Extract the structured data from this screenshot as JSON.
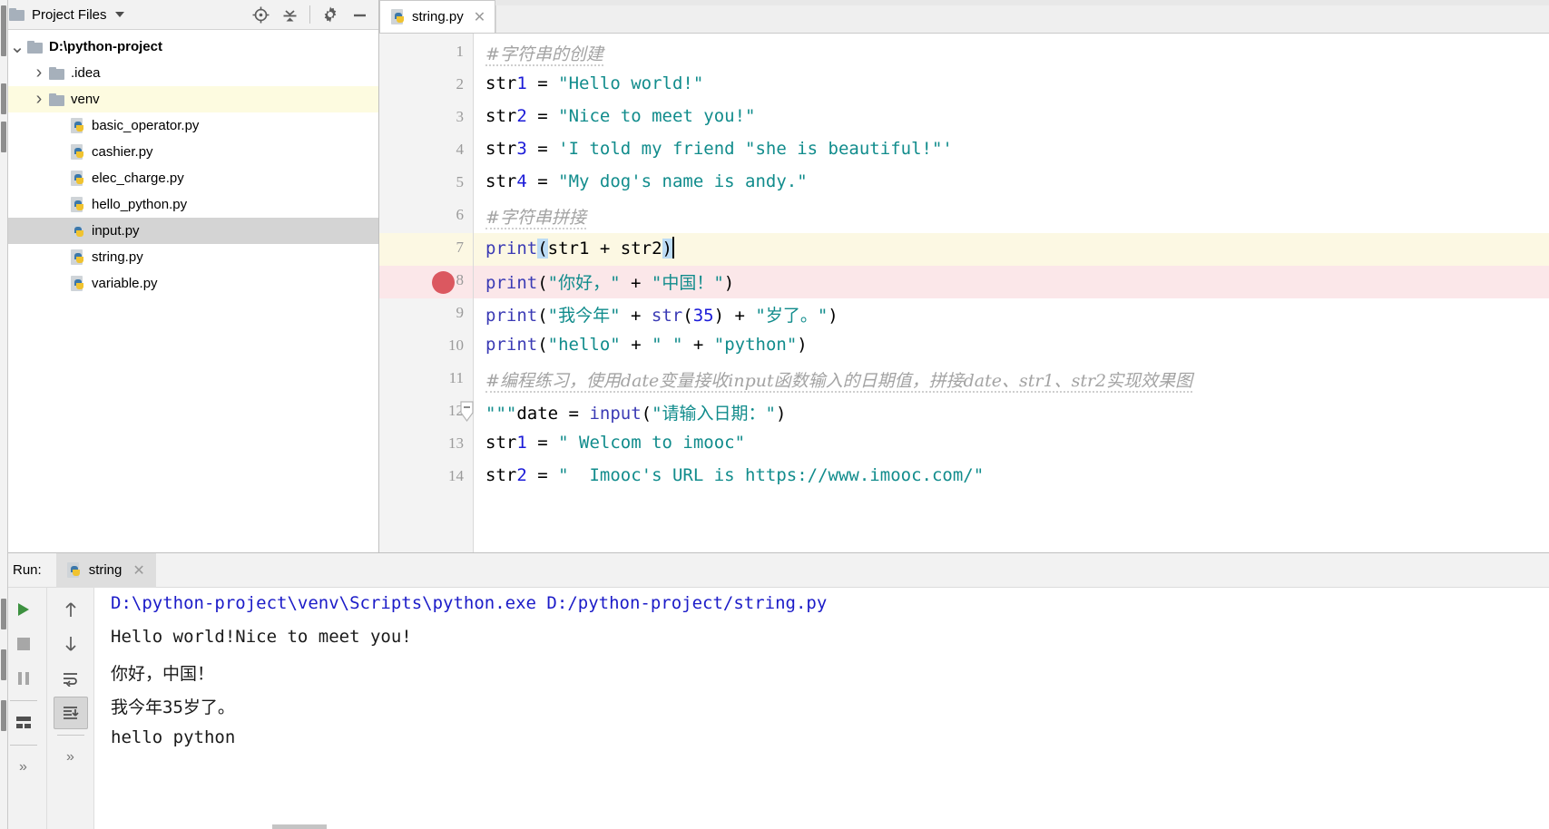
{
  "project_panel": {
    "title": "Project Files",
    "dropdown_icon": "chevron-down-icon",
    "tools": [
      {
        "name": "locate-icon",
        "label": "Select Opened File"
      },
      {
        "name": "collapse-all-icon",
        "label": "Collapse All"
      },
      {
        "name": "gear-icon",
        "label": "Settings"
      },
      {
        "name": "minimize-icon",
        "label": "Hide"
      }
    ],
    "tree": [
      {
        "label": "D:\\python-project",
        "type": "folder",
        "depth": 0,
        "twist": "expanded",
        "bold": true,
        "state": "normal"
      },
      {
        "label": ".idea",
        "type": "folder",
        "depth": 1,
        "twist": "collapsed",
        "bold": false,
        "state": "normal"
      },
      {
        "label": "venv",
        "type": "folder",
        "depth": 1,
        "twist": "collapsed",
        "bold": false,
        "state": "hover"
      },
      {
        "label": "basic_operator.py",
        "type": "python",
        "depth": 2,
        "twist": "none",
        "bold": false,
        "state": "normal"
      },
      {
        "label": "cashier.py",
        "type": "python",
        "depth": 2,
        "twist": "none",
        "bold": false,
        "state": "normal"
      },
      {
        "label": "elec_charge.py",
        "type": "python",
        "depth": 2,
        "twist": "none",
        "bold": false,
        "state": "normal"
      },
      {
        "label": "hello_python.py",
        "type": "python",
        "depth": 2,
        "twist": "none",
        "bold": false,
        "state": "normal"
      },
      {
        "label": "input.py",
        "type": "python",
        "depth": 2,
        "twist": "none",
        "bold": false,
        "state": "selected"
      },
      {
        "label": "string.py",
        "type": "python",
        "depth": 2,
        "twist": "none",
        "bold": false,
        "state": "normal"
      },
      {
        "label": "variable.py",
        "type": "python",
        "depth": 2,
        "twist": "none",
        "bold": false,
        "state": "normal"
      }
    ]
  },
  "editor": {
    "tab": {
      "label": "string.py",
      "icon": "python-file-icon",
      "close_icon": "close-icon"
    },
    "caret_line": 7,
    "breakpoint_line": 8,
    "fold_line": 12,
    "lines": [
      {
        "n": 1,
        "text": "#字符串的创建"
      },
      {
        "n": 2,
        "text": "str1 = \"Hello world!\""
      },
      {
        "n": 3,
        "text": "str2 = \"Nice to meet you!\""
      },
      {
        "n": 4,
        "text": "str3 = 'I told my friend \"she is beautiful!\"'"
      },
      {
        "n": 5,
        "text": "str4 = \"My dog's name is andy.\""
      },
      {
        "n": 6,
        "text": "#字符串拼接"
      },
      {
        "n": 7,
        "text": "print(str1 + str2)"
      },
      {
        "n": 8,
        "text": "print(\"你好，\" + \"中国！\")"
      },
      {
        "n": 9,
        "text": "print(\"我今年\" + str(35) + \"岁了。\")"
      },
      {
        "n": 10,
        "text": "print(\"hello\" + \" \" + \"python\")"
      },
      {
        "n": 11,
        "text": "#编程练习，使用date变量接收input函数输入的日期值，拼接date、str1、str2实现效果图"
      },
      {
        "n": 12,
        "text": "\"\"\"date = input(\"请输入日期：\")"
      },
      {
        "n": 13,
        "text": "str1 = \" Welcom to imooc\""
      },
      {
        "n": 14,
        "text": "str2 = \"  Imooc's URL is https://www.imooc.com/\""
      }
    ]
  },
  "run_panel": {
    "label": "Run:",
    "tab": {
      "label": "string",
      "icon": "python-file-icon",
      "close_icon": "close-icon"
    },
    "tools_left": [
      {
        "name": "run-icon",
        "label": "Rerun"
      },
      {
        "name": "stop-icon",
        "label": "Stop"
      },
      {
        "name": "pause-icon",
        "label": "Pause Output"
      },
      {
        "name": "layout-icon",
        "label": "Layout"
      },
      {
        "name": "more-icon",
        "label": "More"
      }
    ],
    "tools_right": [
      {
        "name": "arrow-up-icon",
        "label": "Up the Stack Trace"
      },
      {
        "name": "arrow-down-icon",
        "label": "Down the Stack Trace"
      },
      {
        "name": "soft-wrap-icon",
        "label": "Soft-Wrap"
      },
      {
        "name": "scroll-to-end-icon",
        "label": "Scroll to End",
        "active": true
      },
      {
        "name": "more-icon",
        "label": "More"
      }
    ],
    "console": [
      {
        "text": "D:\\python-project\\venv\\Scripts\\python.exe D:/python-project/string.py",
        "kind": "cmd"
      },
      {
        "text": "Hello world!Nice to meet you!",
        "kind": "out"
      },
      {
        "text": "你好，中国！",
        "kind": "out"
      },
      {
        "text": "我今年35岁了。",
        "kind": "out"
      },
      {
        "text": "hello python",
        "kind": "out"
      }
    ]
  },
  "colors": {
    "string": "#118c8c",
    "keyword": "#2f2fb0",
    "comment": "#a3a3a3",
    "number": "#1b1bd8",
    "breakpoint": "#db5860",
    "caret_row": "#fcf8e3",
    "breakpoint_row": "#fbe7e9",
    "selection": "#bcdcf5",
    "console_cmd": "#1b1bc8"
  }
}
